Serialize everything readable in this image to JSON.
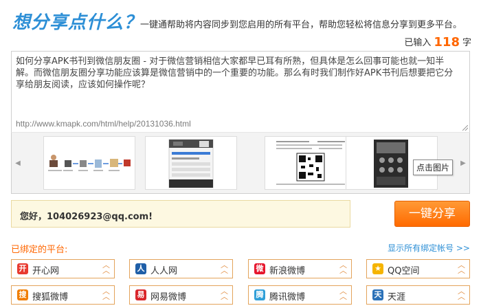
{
  "header": {
    "title": "想分享点什么？",
    "subtitle": "一键通帮助将内容同步到您启用的所有平台，帮助您轻松将信息分享到更多平台。",
    "counter_prefix": "已输入",
    "counter_value": "118",
    "counter_suffix": "字"
  },
  "editor": {
    "text": "如何分享APK书刊到微信朋友圈 - 对于微信营销相信大家都早已耳有所熟，但具体是怎么回事可能也就一知半解。而微信朋友圈分享功能应该算是微信营销中的一个重要的功能。那么有时我们制作好APK书刊后想要把它分享给朋友阅读，应该如何操作呢？",
    "url": "http://www.kmapk.com/html/help/20131036.html"
  },
  "strip": {
    "tooltip": "点击图片",
    "thumbnails": [
      "flow-diagram",
      "app-screenshot",
      "qr-code-page",
      "phone-screenshot"
    ]
  },
  "greeting": {
    "text": "您好，104026923@qq.com!"
  },
  "share_button": {
    "label": "一键分享"
  },
  "platforms": {
    "bound_label": "已绑定的平台:",
    "show_all": "显示所有绑定帐号 >>",
    "items": [
      {
        "name": "开心网",
        "icon": "kaixin-icon",
        "color": "#e8392f"
      },
      {
        "name": "人人网",
        "icon": "renren-icon",
        "color": "#1f5fa8"
      },
      {
        "name": "新浪微博",
        "icon": "sina-weibo-icon",
        "color": "#e6162d"
      },
      {
        "name": "QQ空间",
        "icon": "qzone-icon",
        "color": "#f5b400"
      },
      {
        "name": "搜狐微博",
        "icon": "sohu-weibo-icon",
        "color": "#f07d00"
      },
      {
        "name": "网易微博",
        "icon": "netease-weibo-icon",
        "color": "#d9262b"
      },
      {
        "name": "腾讯微博",
        "icon": "tencent-weibo-icon",
        "color": "#2f9fd8"
      },
      {
        "name": "天涯",
        "icon": "tianya-icon",
        "color": "#2b71b8"
      }
    ]
  },
  "colors": {
    "accent_blue": "#2d8fd6",
    "accent_orange": "#ff6600"
  }
}
